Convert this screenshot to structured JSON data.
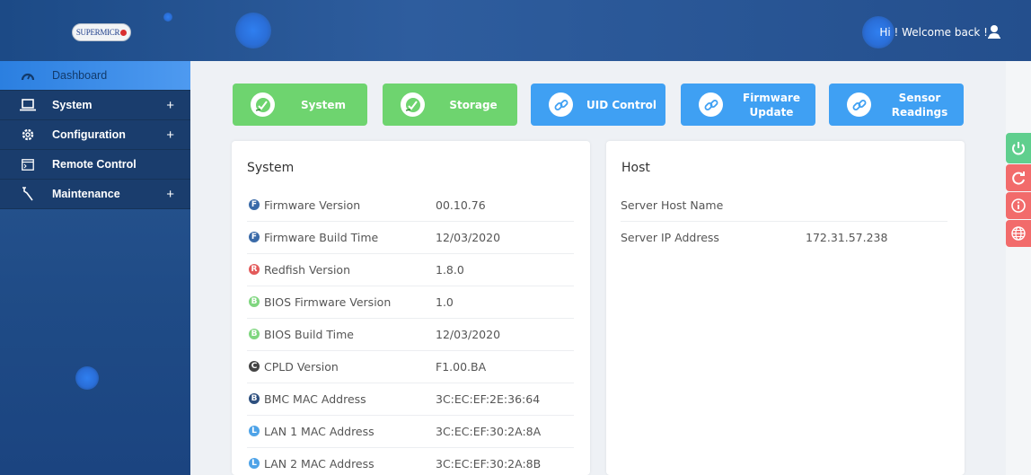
{
  "header": {
    "logo_text": "SUPERMICR",
    "welcome_text": "Hi ! Welcome back !",
    "user_icon": "user-icon"
  },
  "sidebar": {
    "items": [
      {
        "label": "Dashboard",
        "icon": "dashboard-gauge-icon",
        "expandable": false,
        "active": true
      },
      {
        "label": "System",
        "icon": "laptop-icon",
        "expandable": true,
        "plus": "+"
      },
      {
        "label": "Configuration",
        "icon": "gear-icon",
        "expandable": true,
        "plus": "+"
      },
      {
        "label": "Remote Control",
        "icon": "console-window-icon",
        "expandable": false
      },
      {
        "label": "Maintenance",
        "icon": "wrench-icon",
        "expandable": true,
        "plus": "+"
      }
    ]
  },
  "quick_buttons": [
    {
      "label": "System",
      "color": "#6ed46f",
      "icon": "check-circle-icon"
    },
    {
      "label": "Storage",
      "color": "#6ed46f",
      "icon": "check-circle-icon"
    },
    {
      "label": "UID Control",
      "color": "#3fa0f3",
      "icon": "link-icon"
    },
    {
      "label_line1": "Firmware",
      "label_line2": "Update",
      "color": "#3fa0f3",
      "icon": "link-icon"
    },
    {
      "label_line1": "Sensor",
      "label_line2": "Readings",
      "color": "#3fa0f3",
      "icon": "link-icon"
    }
  ],
  "system_card": {
    "title": "System",
    "rows": [
      {
        "badge": "F",
        "badge_color": "#3a6aa8",
        "label": "Firmware Version",
        "value": "00.10.76"
      },
      {
        "badge": "F",
        "badge_color": "#3a6aa8",
        "label": "Firmware Build Time",
        "value": "12/03/2020"
      },
      {
        "badge": "R",
        "badge_color": "#e35a5a",
        "label": "Redfish Version",
        "value": "1.8.0"
      },
      {
        "badge": "B",
        "badge_color": "#7fd67f",
        "label": "BIOS Firmware Version",
        "value": "1.0"
      },
      {
        "badge": "B",
        "badge_color": "#7fd67f",
        "label": "BIOS Build Time",
        "value": "12/03/2020"
      },
      {
        "badge": "C",
        "badge_color": "#444444",
        "label": "CPLD Version",
        "value": "F1.00.BA"
      },
      {
        "badge": "B",
        "badge_color": "#2d4f7e",
        "label": "BMC MAC Address",
        "value": "3C:EC:EF:2E:36:64"
      },
      {
        "badge": "L",
        "badge_color": "#4ea3e8",
        "label": "LAN 1 MAC Address",
        "value": "3C:EC:EF:30:2A:8A"
      },
      {
        "badge": "L",
        "badge_color": "#4ea3e8",
        "label": "LAN 2 MAC Address",
        "value": "3C:EC:EF:30:2A:8B"
      }
    ]
  },
  "host_card": {
    "title": "Host",
    "rows": [
      {
        "label": "Server Host Name",
        "value": ""
      },
      {
        "label": "Server IP Address",
        "value": "172.31.57.238"
      }
    ]
  },
  "floating_buttons": [
    {
      "icon": "power-icon",
      "color": "#5fcf8e"
    },
    {
      "icon": "refresh-icon",
      "color": "#f26b6b"
    },
    {
      "icon": "info-icon",
      "color": "#f26b6b"
    },
    {
      "icon": "globe-icon",
      "color": "#f26b6b"
    }
  ]
}
